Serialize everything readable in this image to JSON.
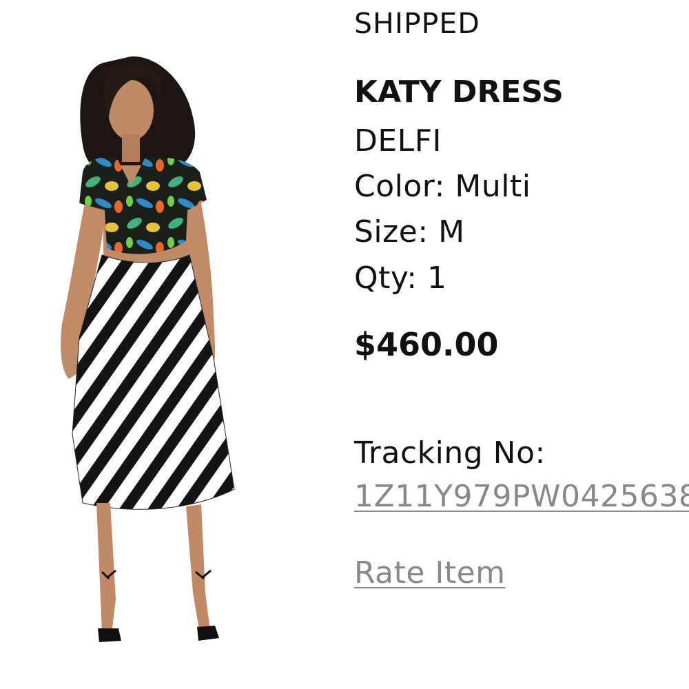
{
  "order_item": {
    "status": "SHIPPED",
    "product_name": "KATY DRESS",
    "brand": "DELFI",
    "color_label": "Color: Multi",
    "size_label": "Size: M",
    "qty_label": "Qty: 1",
    "price": "$460.00",
    "tracking_label": "Tracking No:",
    "tracking_number": "1Z11Y979PW0425638",
    "rate_item_label": "Rate Item",
    "link_color": "#888888"
  }
}
